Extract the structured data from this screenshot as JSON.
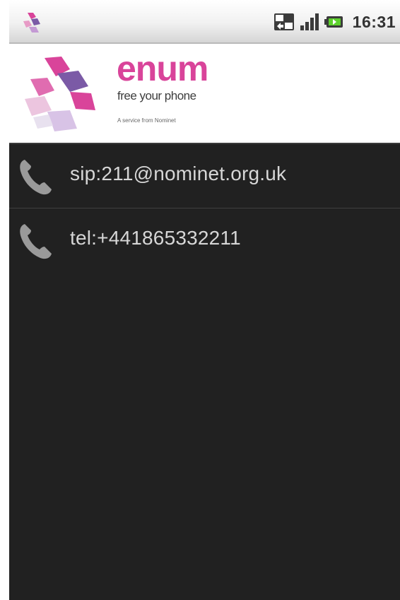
{
  "status_bar": {
    "time": "16:31",
    "icons": [
      "enum-notification-icon",
      "3g-icon",
      "signal-icon",
      "battery-icon"
    ]
  },
  "header": {
    "brand": "enum",
    "tagline": "free your phone",
    "byline": "A service from Nominet"
  },
  "contacts": [
    {
      "icon": "phone-icon",
      "uri": "sip:211@nominet.org.uk"
    },
    {
      "icon": "phone-icon",
      "uri": "tel:+441865332211"
    }
  ],
  "colors": {
    "brand_pink": "#d9449a",
    "brand_purple": "#7b5aa6",
    "list_background": "#212121",
    "list_text": "#d6d6d6"
  }
}
